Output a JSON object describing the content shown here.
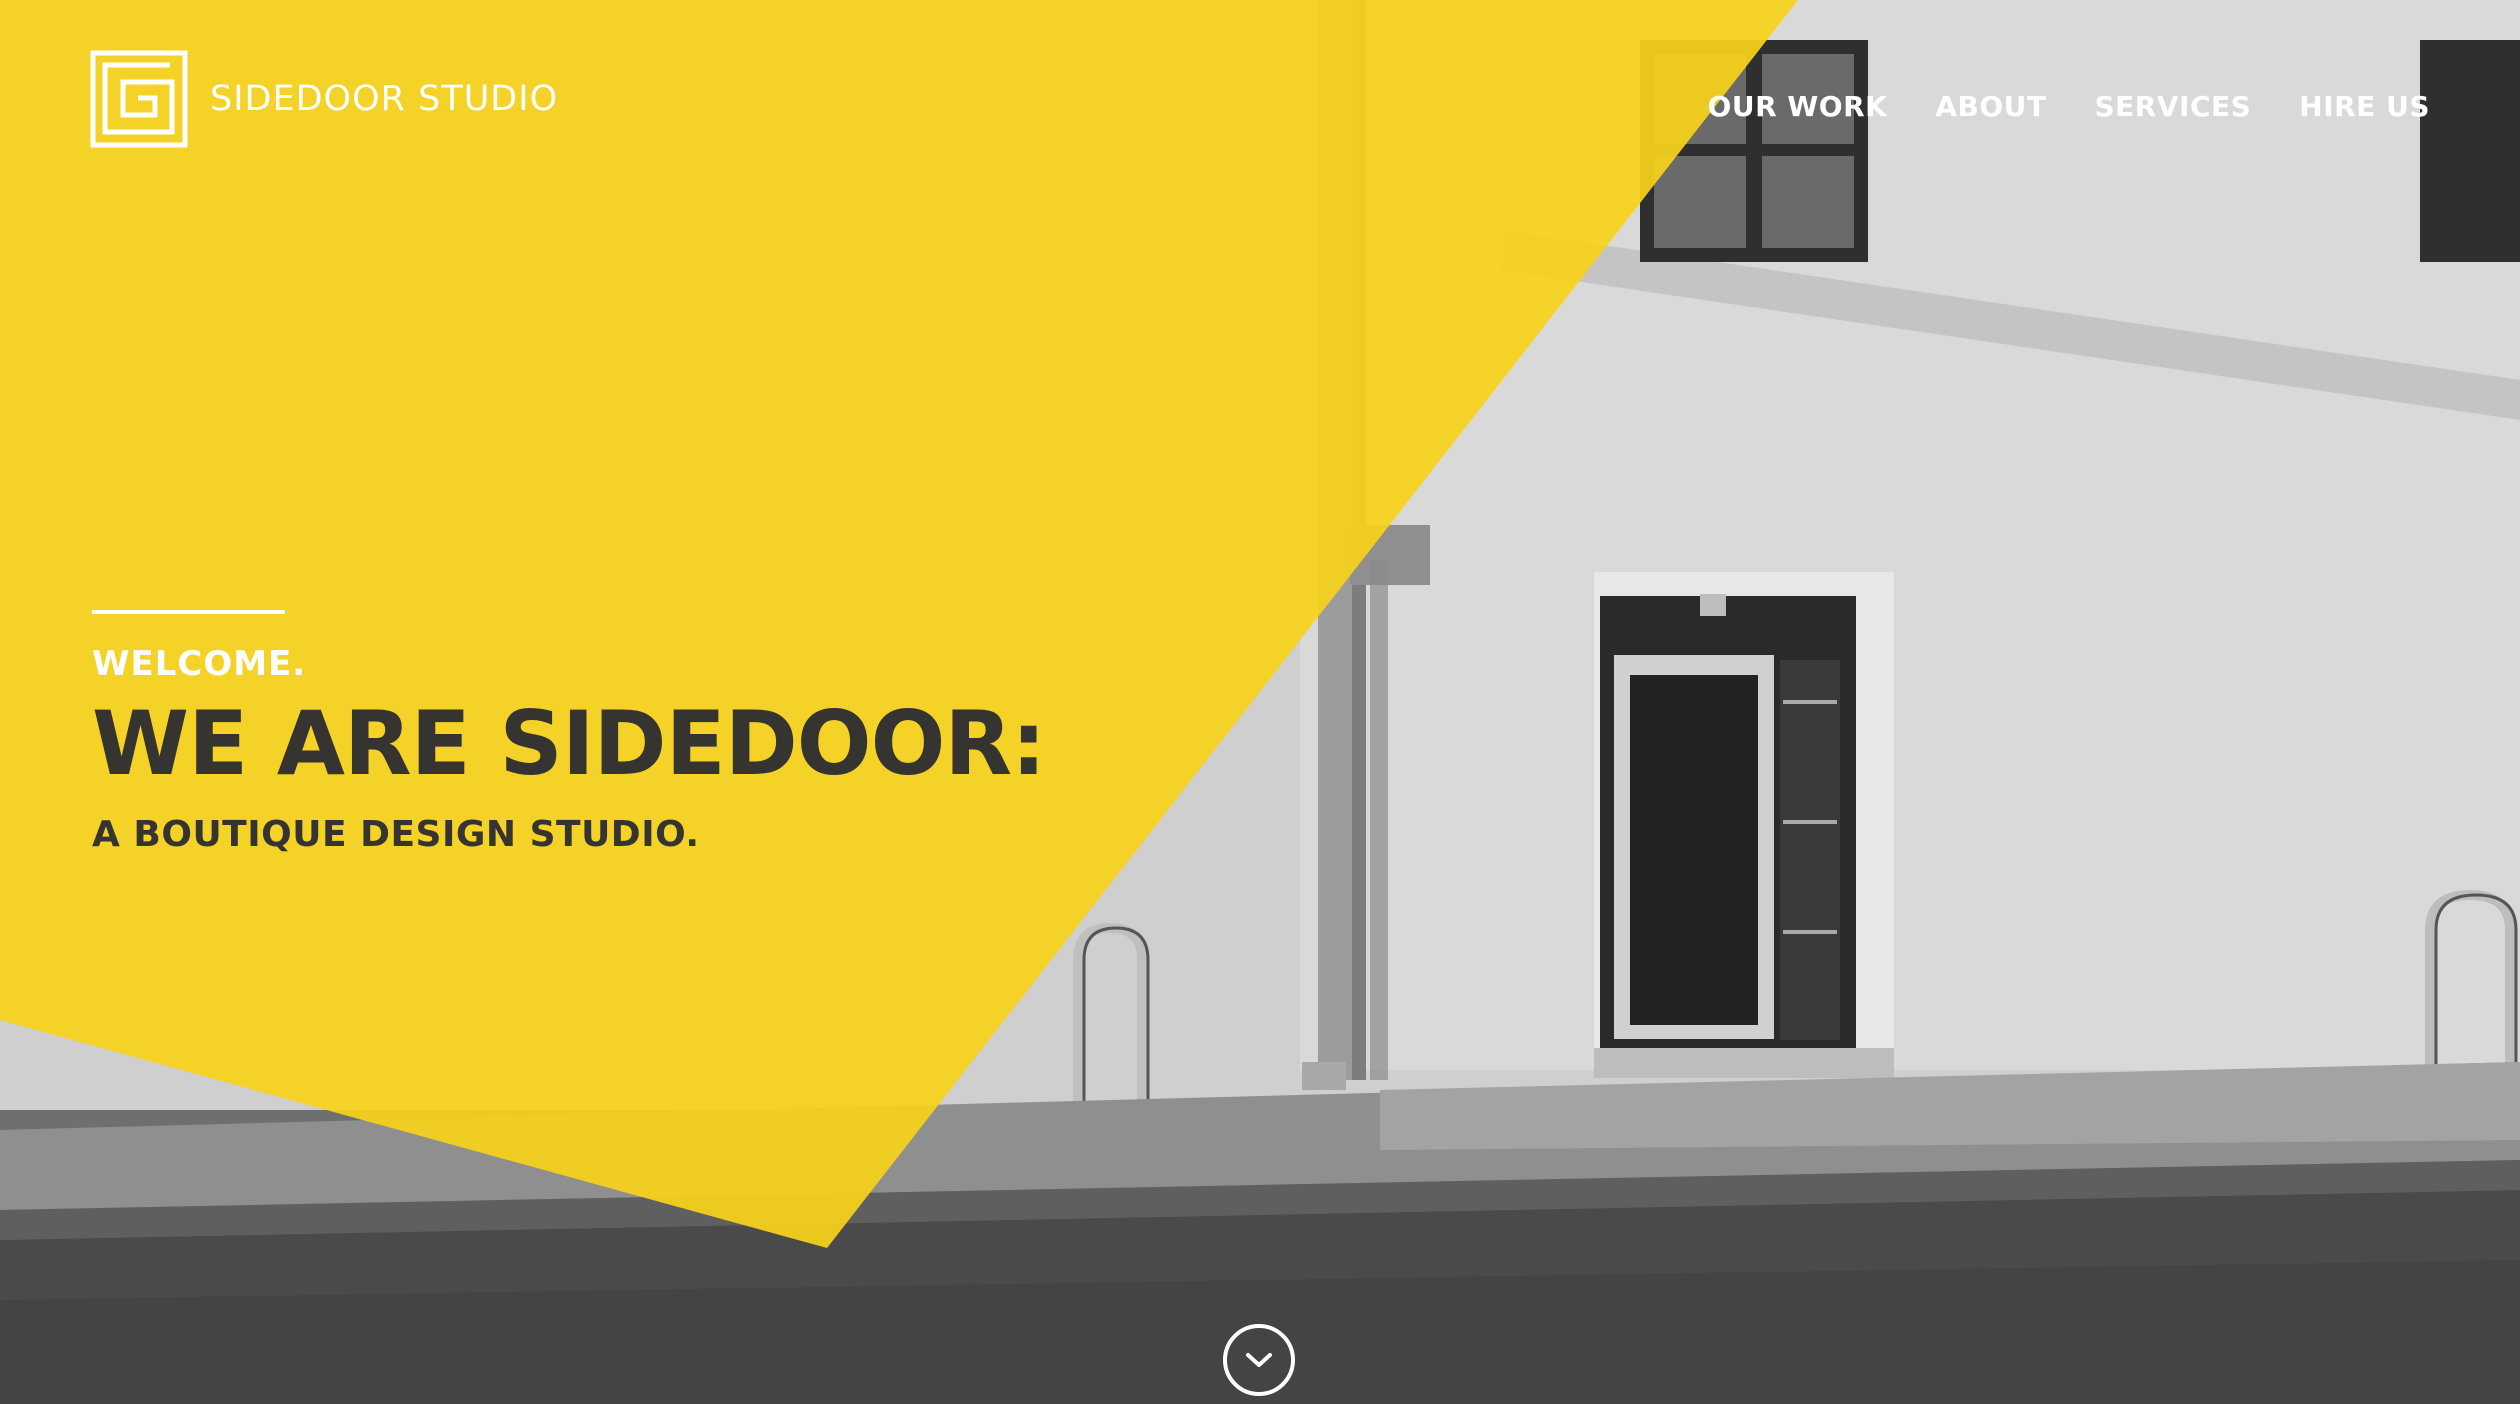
{
  "brand": {
    "name": "SIDEDOOR STUDIO",
    "logo_icon": "sidedoor-maze-logo-icon"
  },
  "nav": {
    "items": [
      {
        "label": "OUR WORK"
      },
      {
        "label": "ABOUT"
      },
      {
        "label": "SERVICES"
      },
      {
        "label": "HIRE US"
      }
    ]
  },
  "hero": {
    "welcome": "WELCOME.",
    "headline": "WE ARE SIDEDOOR:",
    "subhead": "A BOUTIQUE DESIGN STUDIO.",
    "scroll_icon": "chevron-down-icon"
  },
  "colors": {
    "accent_yellow": "#F7D21A",
    "headline_text": "#353431",
    "nav_text": "#FFFFFF"
  }
}
